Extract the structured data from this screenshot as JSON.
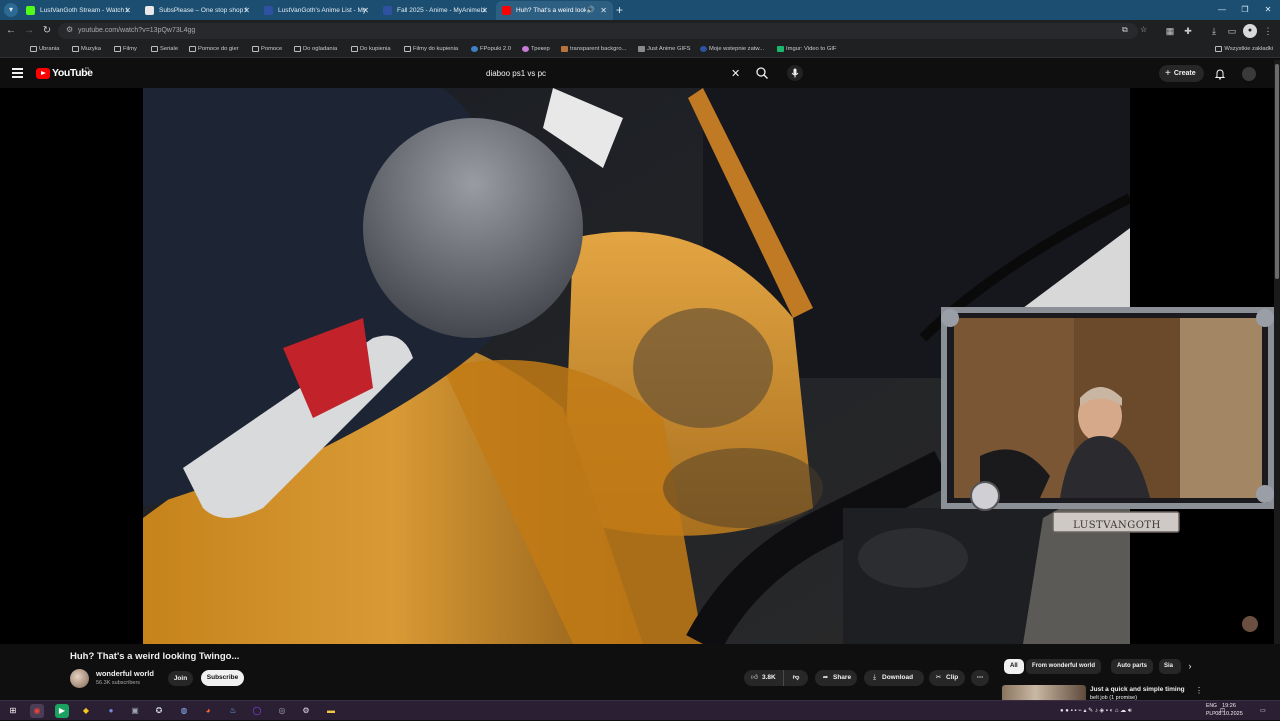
{
  "browser": {
    "tabs": [
      {
        "title": "LustVanGoth Stream - Watch Li",
        "favicon_color": "#53fc18",
        "active": false
      },
      {
        "title": "SubsPlease – One stop shop fo",
        "favicon_color": "#e8e8e8",
        "active": false
      },
      {
        "title": "LustVanGoth's Anime List - My",
        "favicon_color": "#2e51a2",
        "active": false
      },
      {
        "title": "Fall 2025 - Anime - MyAnimeLi",
        "favicon_color": "#2e51a2",
        "active": false
      },
      {
        "title": "Huh? That's a weird looking",
        "favicon_color": "#ff0000",
        "active": true
      }
    ],
    "url": "youtube.com/watch?v=13pQw73L4gg",
    "bookmarks": [
      {
        "label": "Ubrania",
        "type": "folder"
      },
      {
        "label": "Muzyka",
        "type": "folder"
      },
      {
        "label": "Filmy",
        "type": "folder"
      },
      {
        "label": "Seriale",
        "type": "folder"
      },
      {
        "label": "Pomoce do gier",
        "type": "folder"
      },
      {
        "label": "Pomoce",
        "type": "folder"
      },
      {
        "label": "Do ogladania",
        "type": "folder"
      },
      {
        "label": "Do kupienia",
        "type": "folder"
      },
      {
        "label": "Filmy do kupienia",
        "type": "folder"
      },
      {
        "label": "FPopuki 2.0",
        "type": "site"
      },
      {
        "label": "Трекер",
        "type": "site"
      },
      {
        "label": "transparent backgro...",
        "type": "site"
      },
      {
        "label": "Just Anime GIFS",
        "type": "site"
      },
      {
        "label": "Moje wstepnie zatw...",
        "type": "site"
      },
      {
        "label": "Imgur: Video to GIF",
        "type": "site"
      }
    ],
    "all_bookmarks_label": "Wszystkie zakładki"
  },
  "youtube": {
    "logo_text": "YouTube",
    "country_code": "PL",
    "search_query": "diaboo ps1 vs pc",
    "create_label": "Create"
  },
  "video": {
    "title": "Huh? That's a weird looking Twingo...",
    "channel": "wonderful world",
    "subscribers": "56.3K subscribers",
    "join_label": "Join",
    "subscribe_label": "Subscribe",
    "likes": "3.8K",
    "share_label": "Share",
    "download_label": "Download",
    "clip_label": "Clip",
    "overlay_name": "LUSTVANGOTH"
  },
  "sidebar": {
    "chips": [
      {
        "label": "All",
        "active": true
      },
      {
        "label": "From wonderful world",
        "active": false
      },
      {
        "label": "Auto parts",
        "active": false
      },
      {
        "label": "Sia",
        "active": false
      }
    ],
    "recommendation": {
      "title": "Just a quick and simple timing",
      "subtitle": "belt job (1 promise)"
    }
  },
  "taskbar": {
    "lang_line1": "ENG",
    "lang_line2": "PLP",
    "time": "19:26",
    "date": "08.10.2025"
  },
  "colors": {
    "youtube_red": "#ff0000",
    "chrome_tabbar": "#1c4e71",
    "taskbar": "#2b1f33"
  }
}
